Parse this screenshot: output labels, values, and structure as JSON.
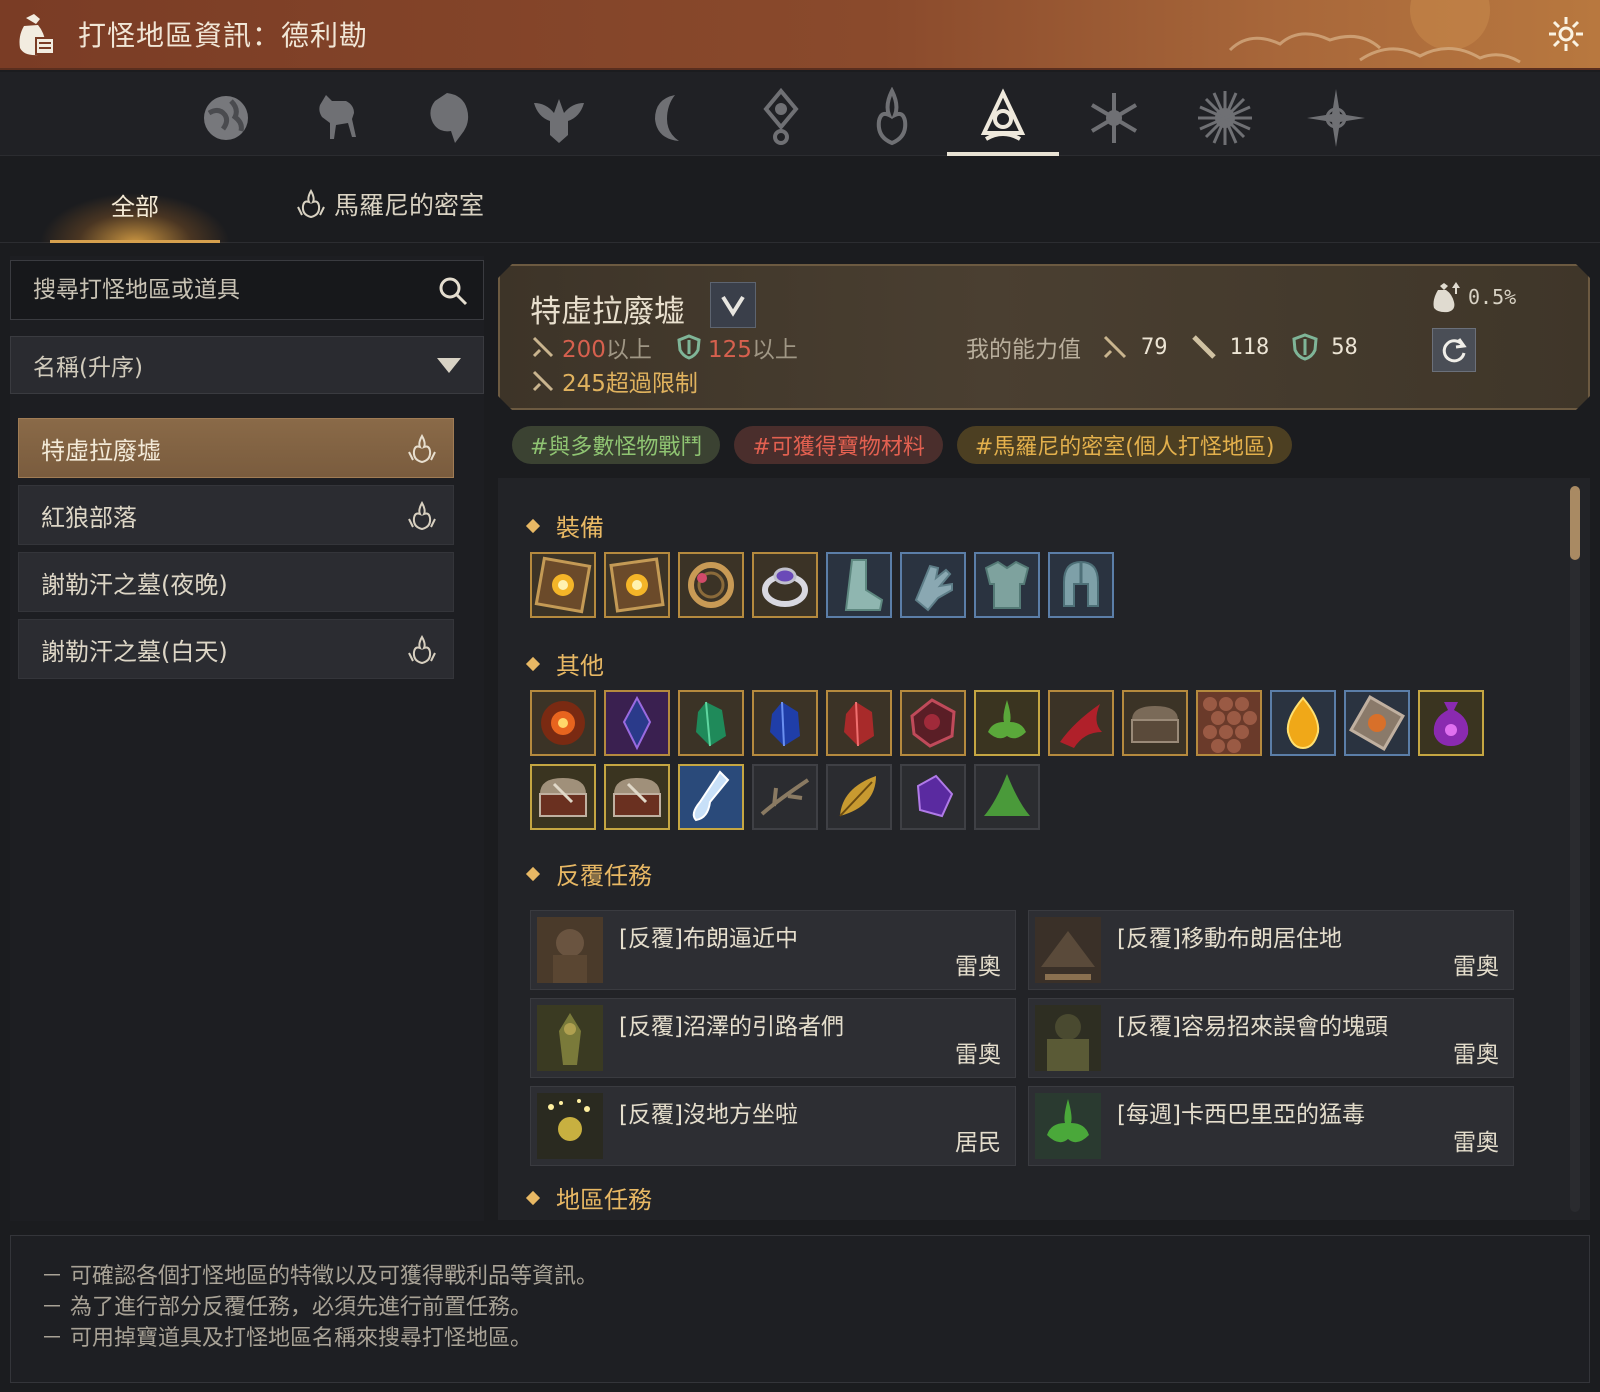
{
  "window": {
    "title": "打怪地區資訊：德利勘"
  },
  "category_tabs": [
    {
      "icon": "globe-icon"
    },
    {
      "icon": "horse-icon"
    },
    {
      "icon": "lion-icon"
    },
    {
      "icon": "winged-crest-icon"
    },
    {
      "icon": "crescent-moon-icon"
    },
    {
      "icon": "orb-pendant-icon"
    },
    {
      "icon": "flame-crest-icon"
    },
    {
      "icon": "tree-emblem-icon",
      "active": true
    },
    {
      "icon": "snowflake-icon"
    },
    {
      "icon": "sunburst-icon"
    },
    {
      "icon": "compass-star-icon"
    }
  ],
  "sub_tabs": {
    "all": "全部",
    "room": "馬羅尼的密室"
  },
  "search": {
    "placeholder": "搜尋打怪地區或道具"
  },
  "sort": {
    "label": "名稱(升序)"
  },
  "zones": [
    {
      "name": "特虛拉廢墟",
      "marony": true,
      "selected": true
    },
    {
      "name": "紅狼部落",
      "marony": true
    },
    {
      "name": "謝勒汗之墓(夜晚)",
      "marony": false
    },
    {
      "name": "謝勒汗之墓(白天)",
      "marony": true
    }
  ],
  "header": {
    "zone_name": "特虛拉廢墟",
    "ap_req": "200",
    "ap_suffix": "以上",
    "dp_req": "125",
    "dp_suffix": "以上",
    "ap_cap": "245",
    "ap_cap_suffix": "超過限制",
    "drop_rate": "0.5%",
    "my_stats_label": "我的能力值",
    "my_ap": "79",
    "my_awk_ap": "118",
    "my_dp": "58"
  },
  "tags": [
    {
      "text": "#與多數怪物戰鬥",
      "color": "green"
    },
    {
      "text": "#可獲得寶物材料",
      "color": "red"
    },
    {
      "text": "#馬羅尼的密室(個人打怪地區)",
      "color": "gold"
    }
  ],
  "sections": {
    "equipment": "裝備",
    "other": "其他",
    "repeat_quests": "反覆任務",
    "region_quests": "地區任務"
  },
  "equipment_items": [
    {
      "icon": "glowing-crystal-box-icon",
      "grade": "gold"
    },
    {
      "icon": "glowing-crystal-box-icon",
      "grade": "gold"
    },
    {
      "icon": "gem-brooch-icon",
      "grade": "gold"
    },
    {
      "icon": "silver-ring-icon",
      "grade": "gold"
    },
    {
      "icon": "armor-boots-icon",
      "grade": "blue"
    },
    {
      "icon": "armor-gloves-icon",
      "grade": "blue"
    },
    {
      "icon": "armor-chest-icon",
      "grade": "blue"
    },
    {
      "icon": "armor-helmet-icon",
      "grade": "blue"
    }
  ],
  "other_items": [
    {
      "icon": "fire-burst-icon",
      "grade": "gold"
    },
    {
      "icon": "purple-crystal-icon",
      "grade": "gold"
    },
    {
      "icon": "green-gem-icon",
      "grade": "gold"
    },
    {
      "icon": "blue-gem-icon",
      "grade": "gold"
    },
    {
      "icon": "red-gem-icon",
      "grade": "gold"
    },
    {
      "icon": "red-ore-icon",
      "grade": "gold"
    },
    {
      "icon": "green-slime-icon",
      "grade": "yellow"
    },
    {
      "icon": "red-claw-icon",
      "grade": "gold"
    },
    {
      "icon": "wooden-chest-icon",
      "grade": "gold"
    },
    {
      "icon": "scale-hide-icon",
      "grade": "gold"
    },
    {
      "icon": "golden-egg-icon",
      "grade": "blue"
    },
    {
      "icon": "amber-stone-icon",
      "grade": "blue"
    },
    {
      "icon": "purple-pouch-icon",
      "grade": "yellow"
    },
    {
      "icon": "ornate-chest-icon",
      "grade": "yellow"
    },
    {
      "icon": "ornate-chest-icon",
      "grade": "yellow"
    },
    {
      "icon": "blue-potion-icon",
      "grade": "yellow"
    },
    {
      "icon": "dry-branch-icon",
      "grade": "gray"
    },
    {
      "icon": "golden-leaf-icon",
      "grade": "gray"
    },
    {
      "icon": "violet-shard-icon",
      "grade": "gray"
    },
    {
      "icon": "green-mound-icon",
      "grade": "gray"
    }
  ],
  "quests": [
    {
      "name": "[反覆]布朗逼近中",
      "npc": "雷奧",
      "icon": "troll-portrait-icon"
    },
    {
      "name": "[反覆]移動布朗居住地",
      "npc": "雷奧",
      "icon": "camp-portrait-icon"
    },
    {
      "name": "[反覆]沼澤的引路者們",
      "npc": "雷奧",
      "icon": "swamp-creature-portrait-icon"
    },
    {
      "name": "[反覆]容易招來誤會的塊頭",
      "npc": "雷奧",
      "icon": "giant-portrait-icon"
    },
    {
      "name": "[反覆]沒地方坐啦",
      "npc": "居民",
      "icon": "glowing-plant-portrait-icon"
    },
    {
      "name": "[每週]卡西巴里亞的猛毒",
      "npc": "雷奧",
      "icon": "green-slime-portrait-icon"
    }
  ],
  "footer": [
    "－ 可確認各個打怪地區的特徵以及可獲得戰利品等資訊。",
    "－ 為了進行部分反覆任務，必須先進行前置任務。",
    "－ 可用掉寶道具及打怪地區名稱來搜尋打怪地區。"
  ],
  "colors": {
    "accent_gold": "#e8b864",
    "selected_zone": "#8a6a48",
    "title_bar": "#8a4a2c",
    "tag_green": "#8fc472",
    "tag_red": "#e26050",
    "tag_gold": "#e3b04c"
  }
}
